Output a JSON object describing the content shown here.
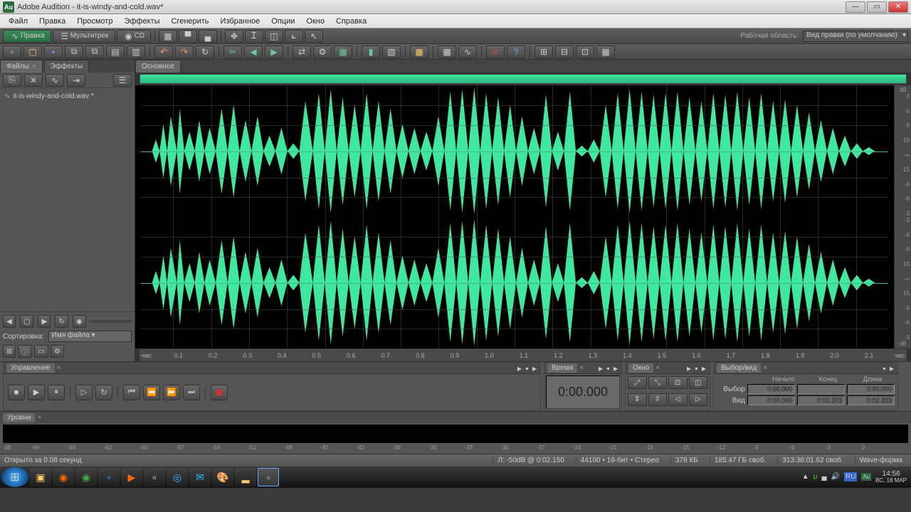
{
  "window": {
    "app": "Adobe Audition",
    "file": "it-is-windy-and-cold.wav*"
  },
  "winbtns": {
    "min": "—",
    "max": "▭",
    "close": "✕"
  },
  "menu": [
    "Файл",
    "Правка",
    "Просмотр",
    "Эффекты",
    "Сгенерить",
    "Избранное",
    "Опции",
    "Окно",
    "Справка"
  ],
  "tb1": {
    "edit": "Правка",
    "multi": "Мультитрек",
    "cd": "CD",
    "workspace_label": "Рабочая область:",
    "workspace": "Вид правки (по умолчанию)"
  },
  "sidebar": {
    "tabs": [
      "Файлы",
      "Эффекты"
    ],
    "file": "it-is-windy-and-cold.wav *",
    "sort_label": "Сортировка:",
    "sort_value": "Имя файла"
  },
  "editor": {
    "tab": "Основное"
  },
  "time_ruler": {
    "unit": "чмс",
    "marks": [
      "0.1",
      "0.2",
      "0.3",
      "0.4",
      "0.5",
      "0.6",
      "0.7",
      "0.8",
      "0.9",
      "1.0",
      "1.1",
      "1.2",
      "1.3",
      "1.4",
      "1.5",
      "1.6",
      "1.7",
      "1.8",
      "1.9",
      "2.0",
      "2.1"
    ]
  },
  "db_marks": [
    "-3",
    "-6",
    "-9",
    "-15",
    "-∞",
    "-15",
    "-9",
    "-6",
    "-3"
  ],
  "db_unit": "dB",
  "panels": {
    "transport": "Управление",
    "time": "Время",
    "zoom": "Окно",
    "view": "Выбор/вид"
  },
  "time_display": "0:00.000",
  "view_panel": {
    "cols": [
      "Начало",
      "Конец",
      "Длина"
    ],
    "rows": [
      {
        "label": "Выбор",
        "vals": [
          "0:00.000",
          "",
          "0:00.000"
        ]
      },
      {
        "label": "Вид",
        "vals": [
          "0:00.000",
          "0:02.203",
          "0:02.203"
        ]
      }
    ]
  },
  "levels": {
    "tab": "Уровни",
    "marks": [
      "-69",
      "-66",
      "-63",
      "-60",
      "-57",
      "-54",
      "-51",
      "-48",
      "-45",
      "-42",
      "-39",
      "-36",
      "-33",
      "-30",
      "-27",
      "-24",
      "-21",
      "-18",
      "-15",
      "-12",
      "-9",
      "-6",
      "-3",
      "0"
    ],
    "unit": "dB"
  },
  "status": {
    "opened": "Открыто за 0.08 секунд",
    "cursor": "Л: -50dB @ 0:02.150",
    "rate": "44100 • 16-бит • Стерео",
    "size": "376 КБ",
    "free": "185.47 ГБ своб.",
    "time_free": "313:36:01.62 своб.",
    "mode": "Wave-форма"
  },
  "taskbar": {
    "time": "14:56",
    "date": "ВС, 18 МАР"
  }
}
